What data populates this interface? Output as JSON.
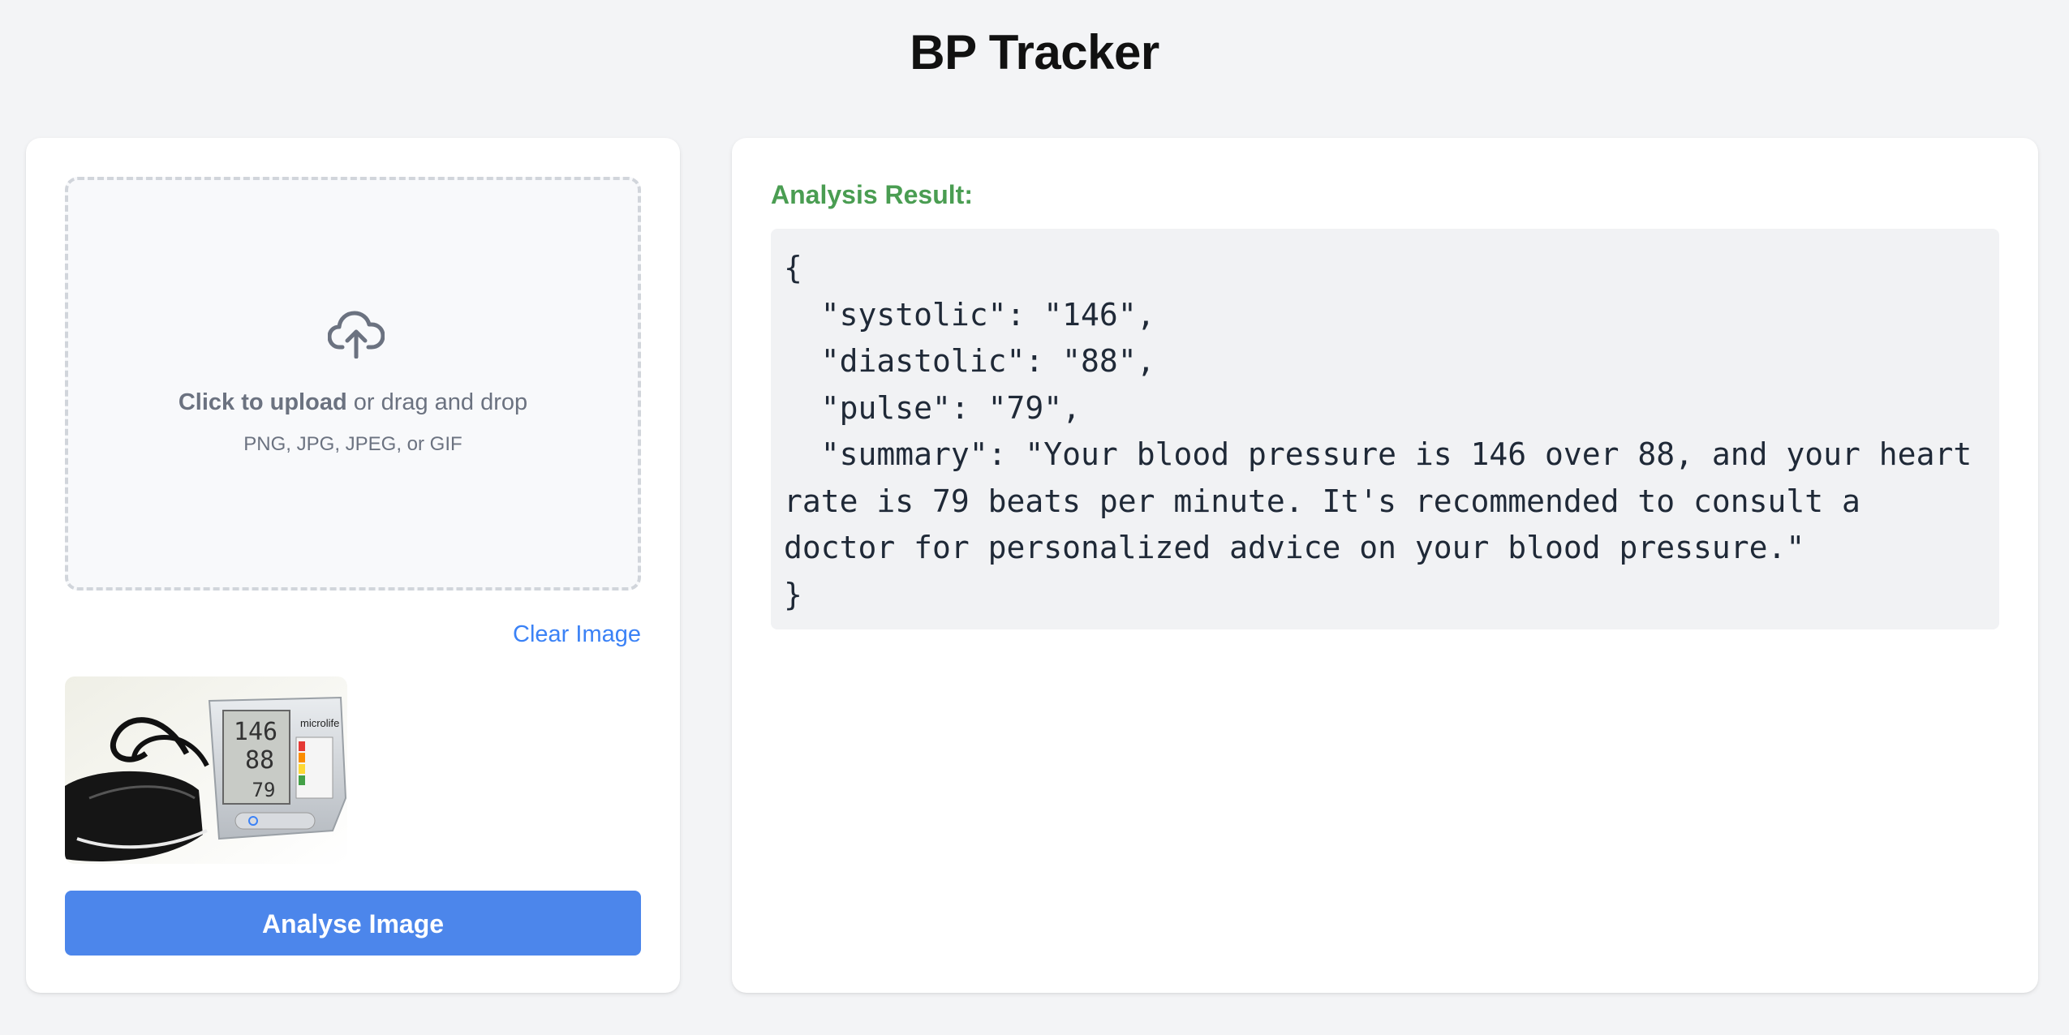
{
  "header": {
    "title": "BP Tracker"
  },
  "upload": {
    "click_label": "Click to upload",
    "drag_label": " or drag and drop",
    "hint": "PNG, JPG, JPEG, or GIF",
    "icon": "cloud-upload-icon"
  },
  "actions": {
    "clear_label": "Clear Image",
    "analyse_label": "Analyse Image"
  },
  "preview": {
    "digits": [
      "146",
      "88",
      "79"
    ],
    "brand": "microlife"
  },
  "result": {
    "heading": "Analysis Result:",
    "json_text": "{\n  \"systolic\": \"146\",\n  \"diastolic\": \"88\",\n  \"pulse\": \"79\",\n  \"summary\": \"Your blood pressure is 146 over 88, and your heart rate is 79 beats per minute. It's recommended to consult a doctor for personalized advice on your blood pressure.\"\n}"
  },
  "colors": {
    "accent": "#4c86eb",
    "link": "#3b82f6",
    "result_heading": "#4a9d52",
    "background": "#f3f4f6"
  }
}
